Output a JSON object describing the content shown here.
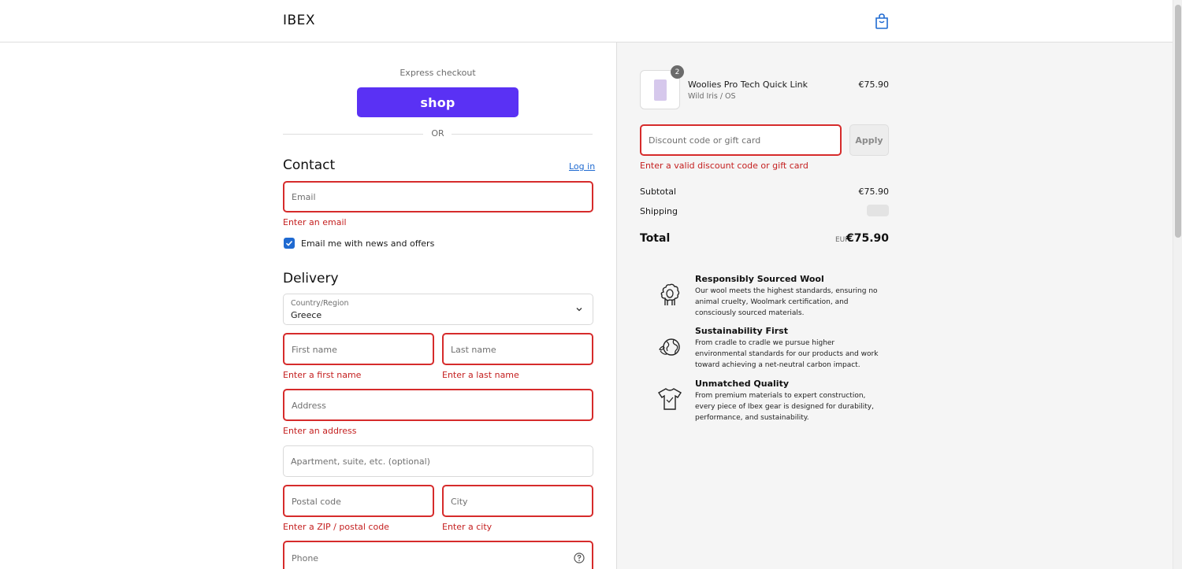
{
  "header": {
    "brand": "IBEX",
    "cart_icon": "shopping-bag-icon"
  },
  "express": {
    "label": "Express checkout",
    "shop_button": "shop",
    "divider": "OR"
  },
  "contact": {
    "title": "Contact",
    "login": "Log in",
    "email_placeholder": "Email",
    "email_error": "Enter an email",
    "newsletter_label": "Email me with news and offers",
    "newsletter_checked": true
  },
  "delivery": {
    "title": "Delivery",
    "country_label": "Country/Region",
    "country_value": "Greece",
    "first_name_placeholder": "First name",
    "first_name_error": "Enter a first name",
    "last_name_placeholder": "Last name",
    "last_name_error": "Enter a last name",
    "address_placeholder": "Address",
    "address_error": "Enter an address",
    "apartment_placeholder": "Apartment, suite, etc. (optional)",
    "postal_placeholder": "Postal code",
    "postal_error": "Enter a ZIP / postal code",
    "city_placeholder": "City",
    "city_error": "Enter a city",
    "phone_placeholder": "Phone"
  },
  "summary": {
    "item": {
      "name": "Woolies Pro Tech Quick Link",
      "variant": "Wild Iris / OS",
      "price": "€75.90",
      "quantity": "2"
    },
    "discount_placeholder": "Discount code or gift card",
    "discount_error": "Enter a valid discount code or gift card",
    "apply_label": "Apply",
    "subtotal_label": "Subtotal",
    "subtotal_value": "€75.90",
    "shipping_label": "Shipping",
    "total_label": "Total",
    "currency": "EUR",
    "total_value": "€75.90"
  },
  "features": [
    {
      "icon": "sheep-icon",
      "title": "Responsibly Sourced Wool",
      "desc": "Our wool meets the highest standards, ensuring no animal cruelty, Woolmark certification, and consciously sourced materials."
    },
    {
      "icon": "globe-icon",
      "title": "Sustainability First",
      "desc": "From cradle to cradle we pursue higher environmental standards for our products and work toward achieving a net-neutral carbon impact."
    },
    {
      "icon": "tshirt-icon",
      "title": "Unmatched Quality",
      "desc": "From premium materials to expert construction, every piece of Ibex gear is designed for durability, performance, and sustainability."
    }
  ],
  "colors": {
    "accent": "#1f6ad1",
    "shop_purple": "#5a31f4",
    "error": "#d62b2b",
    "summary_bg": "#f5f5f5"
  }
}
